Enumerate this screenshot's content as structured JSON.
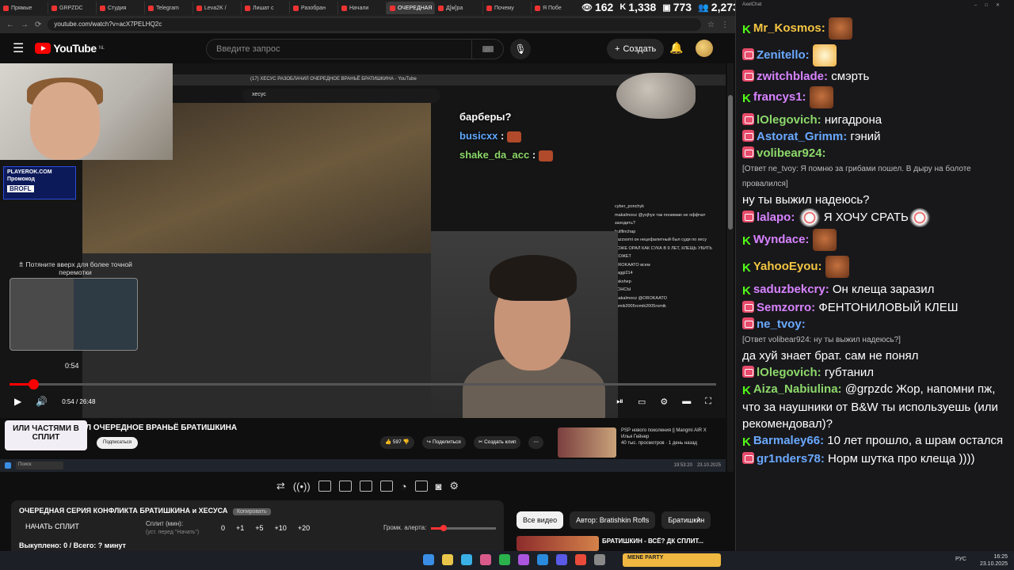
{
  "browser": {
    "tabs": [
      "Прямые",
      "GRPZDC",
      "Студия",
      "Telegram",
      "Leva2K /",
      "Лишат с",
      "Разобран",
      "Начали",
      "ОЧЕРЕДНАЯ",
      "Д[м]ра",
      "Почему",
      "Я Побе"
    ],
    "url": "youtube.com/watch?v=acX7PELHQ2c"
  },
  "stats": [
    {
      "icon": "eye-icon",
      "value": "162"
    },
    {
      "icon": "kick-icon",
      "value": "1,338"
    },
    {
      "icon": "vk-live-icon",
      "value": "773"
    },
    {
      "icon": "users-icon",
      "value": "2,273"
    }
  ],
  "youtube": {
    "logo_text": "YouTube",
    "region": "NL",
    "search_placeholder": "Введите запрос",
    "create_label": "Создать"
  },
  "video": {
    "inner_title": "(17) ХЕСУС РАЗОБЛАЧИЛ ОЧЕРЕДНОЕ ВРАНЬЁ БРАТИШКИНА - YouTube",
    "inner_search": "хесус",
    "promo_site": "PLAYEROK.COM",
    "promo_label": "Промокод",
    "promo_code": "BROFL",
    "pull_hint": "⇯ Потяните вверх для более точной перемотки",
    "hover_time": "0:54",
    "progress": 0.034,
    "time": "0:54 / 26:48",
    "overlay_chat": [
      {
        "text": "барберы?",
        "nick": ""
      },
      {
        "nick": "busicxx",
        "text": ":"
      },
      {
        "nick": "shake_da_acc",
        "text": ":"
      }
    ],
    "mini_chat": [
      "cyber_ponchyk",
      "makalmooz @yxjhye так понимаю не оффчат заходить?",
      "bullfinchap",
      "kazzsomi он нецефалитный был судя по хесу",
      "ТОЖЕ ОРАЛ КАК СУКА В 9 ЛЕТ, КЛЕЩЬ УБИТЬ МОЖЕТ",
      "OROKAATO всем",
      "naggi214",
      "pakshep",
      "КОНСЫ",
      "makalmooz @OROKAATO",
      "romik2005romik2005romik"
    ]
  },
  "below_video": {
    "sticker_text": "ИЛИ ЧАСТЯМИ В СПЛИТ",
    "title": "Л ОЧЕРЕДНОЕ ВРАНЬЁ БРАТИШКИНА",
    "subscribe": "Подписаться",
    "likes": "597",
    "share": "Поделиться",
    "clip": "Создать клип",
    "rec_title": "PSP нового поколения || Mangmi AIR X",
    "rec_channel": "Илья Гейнер",
    "rec_meta": "40 тыс. просмотров · 1 день назад",
    "rec_duration": "16:48"
  },
  "inner_taskbar": {
    "search": "Поиск",
    "clock": "19:53:20",
    "date": "23.10.2025"
  },
  "split_panel": {
    "title": "ОЧЕРЕДНАЯ СЕРИЯ КОНФЛИКТА БРАТИШКИНА и ХЕСУСА",
    "badge": "Копировать",
    "start": "НАЧАТЬ СПЛИТ",
    "split_label": "Сплит (мин):",
    "split_hint": "(уст. перед \"Начать\")",
    "nums": [
      "0",
      "+1",
      "+5",
      "+10",
      "+20"
    ],
    "alert_label": "Громк. алерта:",
    "alert_level": 0.2,
    "footer": "Выкуплено: 0 / Всего: ? минут"
  },
  "chips": [
    "Все видео",
    "Автор: Bratishkin Rofls",
    "Братишкин"
  ],
  "rec_item": {
    "title": "БРАТИШКИН - ВСЁ? ДК СПЛИТ..."
  },
  "chat": {
    "window_title": "AxelChat",
    "messages": [
      {
        "platform": "kick",
        "nick": "Mr_Kosmos:",
        "color": "#f5c542",
        "text": "",
        "emote": "pepe"
      },
      {
        "platform": "vk",
        "nick": "Zenitello:",
        "color": "#6aa9ff",
        "text": "",
        "emote": "sun"
      },
      {
        "platform": "vk",
        "nick": "zwitchblade:",
        "color": "#d783ff",
        "text": "смэрть"
      },
      {
        "platform": "kick",
        "nick": "francys1:",
        "color": "#d783ff",
        "text": "",
        "emote": "pepe"
      },
      {
        "platform": "vk",
        "nick": "lOlegovich:",
        "color": "#8dd86a",
        "text": "нигадрона"
      },
      {
        "platform": "vk",
        "nick": "Astorat_Grimm:",
        "color": "#6aa9ff",
        "text": "гэний"
      },
      {
        "platform": "vk",
        "nick": "volibear924:",
        "color": "#8dd86a",
        "reply": "[Ответ ne_tvoy: Я помню за грибами пошел. В дыру на болоте провалился]",
        "text": "ну ты выжил надеюсь?"
      },
      {
        "platform": "vk",
        "nick": "lalapo:",
        "color": "#d783ff",
        "text": "Я ХОЧУ СРАТЬ",
        "emote": "mask"
      },
      {
        "platform": "kick",
        "nick": "Wyndace:",
        "color": "#d783ff",
        "text": "",
        "emote": "pepe"
      },
      {
        "platform": "kick",
        "nick": "YahooEyou:",
        "color": "#f5c542",
        "text": "",
        "emote": "pepe"
      },
      {
        "platform": "kick",
        "nick": "saduzbekcry:",
        "color": "#d783ff",
        "text": "Он клеща заразил"
      },
      {
        "platform": "vk",
        "nick": "Semzorro:",
        "color": "#d783ff",
        "text": "ФЕНТОНИЛОВЫЙ КЛЕШ"
      },
      {
        "platform": "vk",
        "nick": "ne_tvoy:",
        "color": "#6aa9ff",
        "reply": "[Ответ volibear924: ну ты выжил надеюсь?]",
        "text": "да хуй знает брат. сам не понял"
      },
      {
        "platform": "vk",
        "nick": "lOlegovich:",
        "color": "#8dd86a",
        "text": "губтанил"
      },
      {
        "platform": "kick",
        "nick": "Aiza_Nabiulina:",
        "color": "#8dd86a",
        "text": "@grpzdc Жор, напомни пж, что за наушники от B&W ты используешь (или рекомендовал)?"
      },
      {
        "platform": "kick",
        "nick": "Barmaley66:",
        "color": "#6aa9ff",
        "text": "10 лет прошло, а шрам остался"
      },
      {
        "platform": "vk",
        "nick": "gr1nders78:",
        "color": "#6aa9ff",
        "text": "Норм шутка про клеща ))))"
      }
    ]
  },
  "taskbar": {
    "lang": "РУС",
    "time": "16:25",
    "date": "23.10.2025",
    "game_banner": "MENE PARTY"
  }
}
